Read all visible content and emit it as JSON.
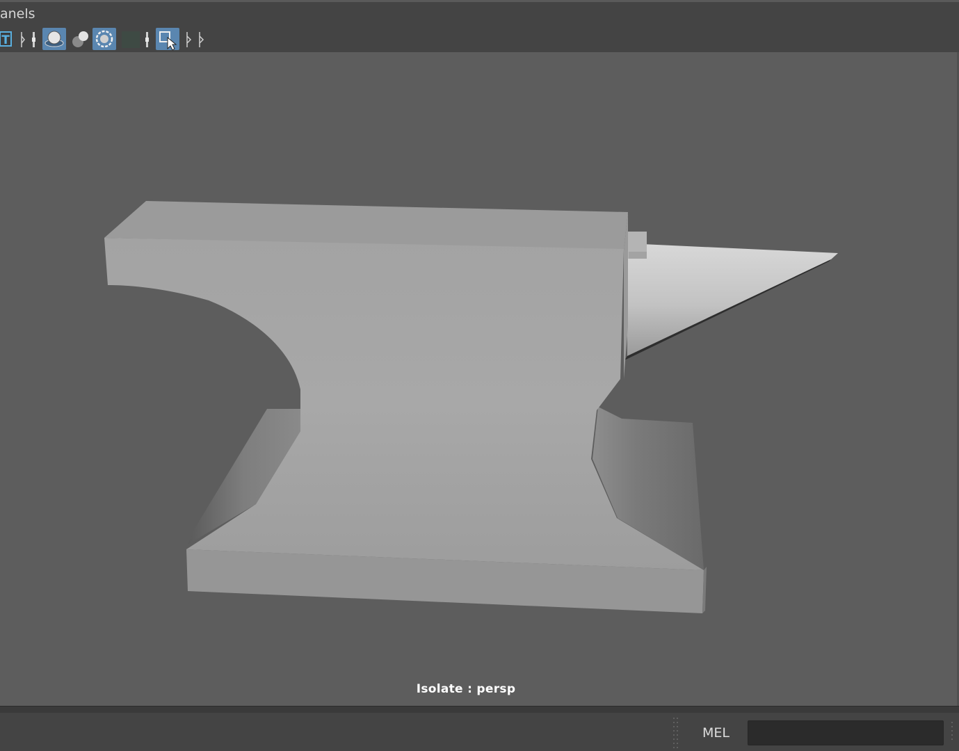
{
  "menubar": {
    "panels_label": "anels"
  },
  "toolbar": {
    "icons": [
      "text-T-icon",
      "separator-handle-icon",
      "smooth-shade-all-icon",
      "lighting-icon",
      "shadows-icon",
      "textured-icon",
      "separator-handle-icon",
      "isolate-select-icon",
      "expand-arrow-icon"
    ]
  },
  "viewport": {
    "camera_label": "Isolate : persp",
    "background_color": "#5d5d5d",
    "model": "anvil"
  },
  "command_line": {
    "language_label": "MEL",
    "input_value": ""
  },
  "colors": {
    "active_icon_bg": "#5a86b0",
    "ui_bg": "#444444"
  }
}
